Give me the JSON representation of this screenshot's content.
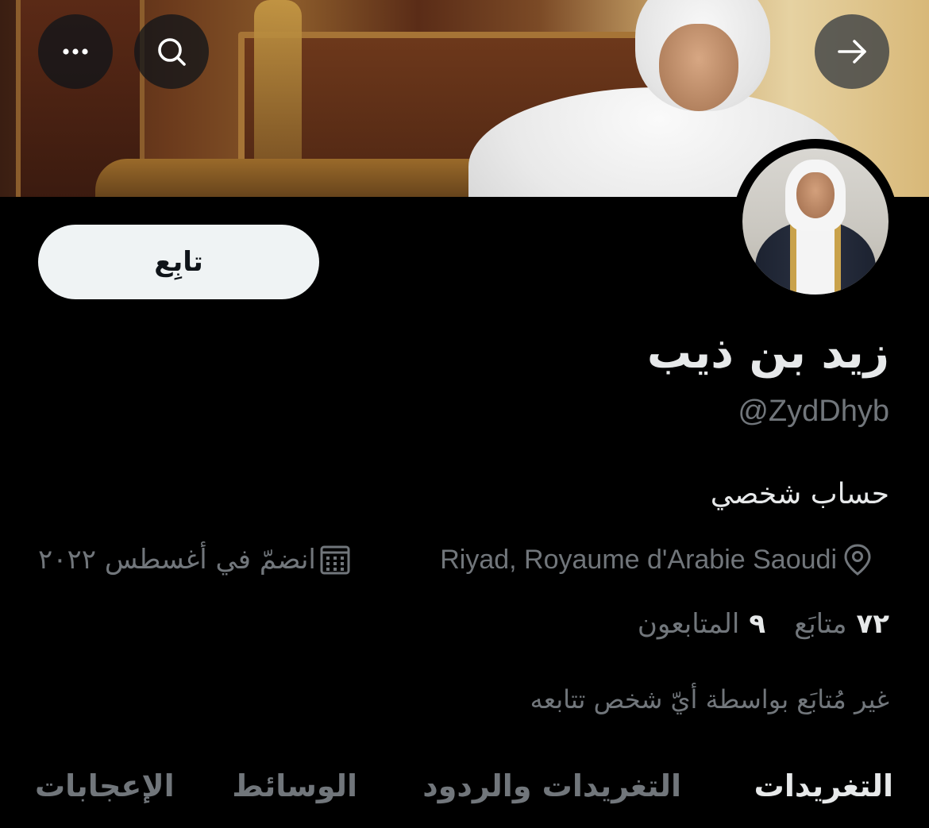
{
  "header": {
    "back_icon": "arrow-right-icon",
    "search_icon": "search-icon",
    "more_icon": "more-horizontal-icon"
  },
  "profile": {
    "name": "زيد بن ذيب",
    "handle": "@ZydDhyb",
    "bio": "حساب شخصي",
    "location": "Riyad, Royaume d'Arabie Saoudi",
    "joined": "انضمّ في أغسطس ٢٠٢٢",
    "follow_label": "تابِع",
    "following_count": "٧٢",
    "following_label": "متابَع",
    "followers_count": "٩",
    "followers_label": "المتابعون",
    "not_followed_text": "غير مُتابَع بواسطة أيّ شخص تتابعه"
  },
  "tabs": [
    {
      "label": "التغريدات",
      "active": true
    },
    {
      "label": "التغريدات والردود",
      "active": false
    },
    {
      "label": "الوسائط",
      "active": false
    },
    {
      "label": "الإعجابات",
      "active": false
    }
  ],
  "colors": {
    "background": "#000000",
    "primary_text": "#e7e9ea",
    "secondary_text": "#71767b",
    "follow_button_bg": "#eff3f4"
  }
}
